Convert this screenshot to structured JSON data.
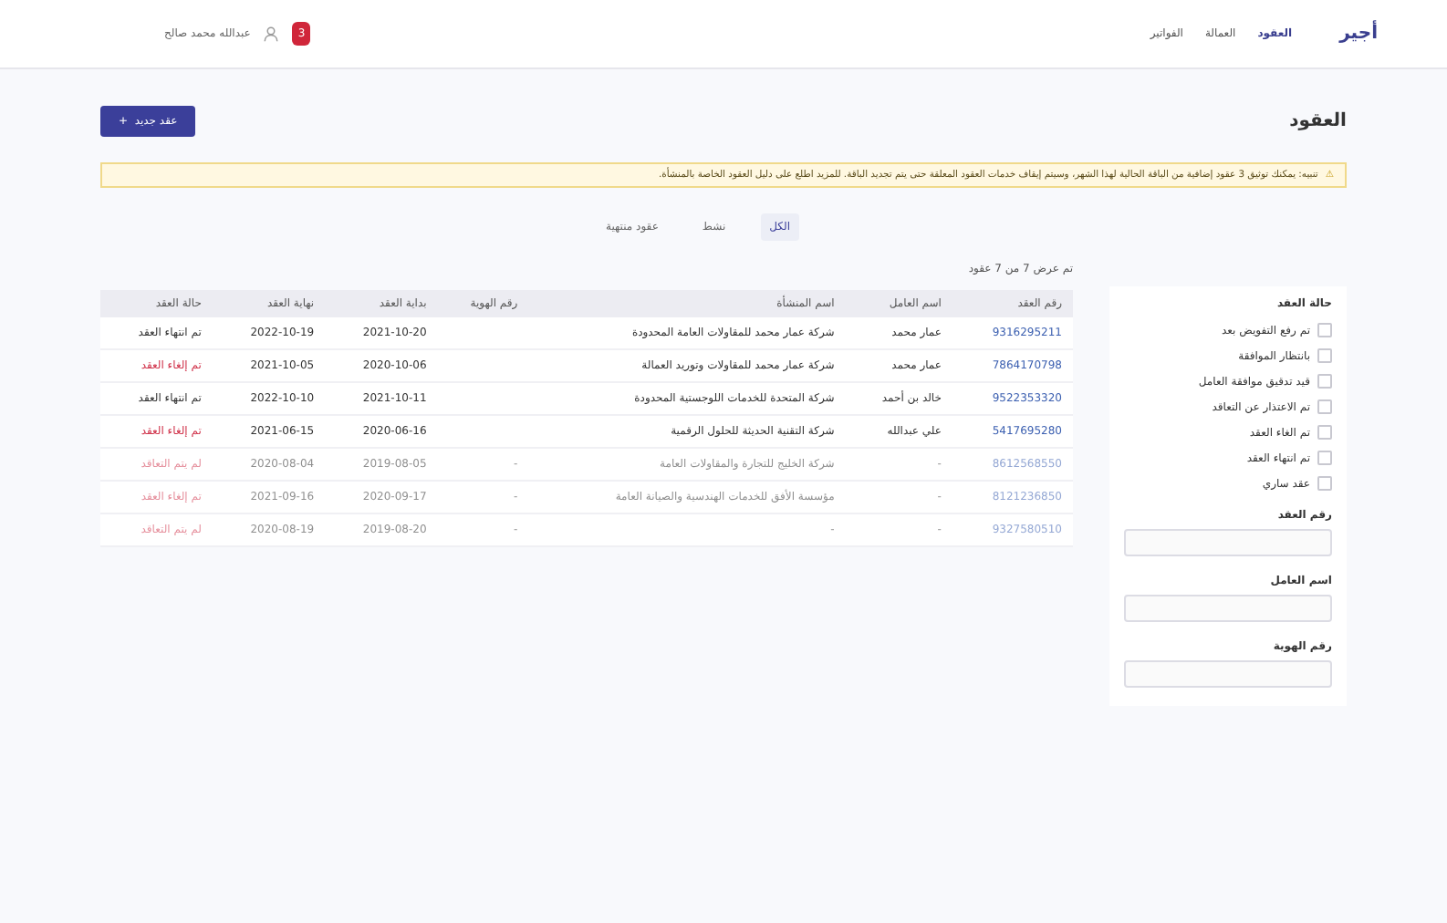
{
  "header": {
    "logo_text": "أجير",
    "nav": [
      {
        "label": "العقود",
        "selected": true
      },
      {
        "label": "العمالة",
        "selected": false
      },
      {
        "label": "الفواتير",
        "selected": false
      }
    ],
    "notifications": "3",
    "user": "عبدالله محمد صالح"
  },
  "page": {
    "title": "العقود",
    "new_button": "عقد جديد",
    "new_icon": "+"
  },
  "alert": {
    "icon": "⚠",
    "text": "تنبيه: يمكنك توثيق 3 عقود إضافية من الباقة الحالية لهذا الشهر، وسيتم إيقاف خدمات العقود المعلقة حتى يتم تجديد الباقة. للمزيد اطلع على دليل العقود الخاصة بالمنشأة."
  },
  "tabs": [
    {
      "label": "الكل",
      "selected": true
    },
    {
      "label": "نشط",
      "selected": false
    },
    {
      "label": "عقود منتهية",
      "selected": false
    }
  ],
  "filters": {
    "title": "حالة العقد",
    "options": [
      {
        "label": "تم رفع التفويض بعد",
        "checked": false
      },
      {
        "label": "بانتظار الموافقة",
        "checked": false
      },
      {
        "label": "قيد تدقيق موافقة العامل",
        "checked": false
      },
      {
        "label": "تم الاعتذار عن التعاقد",
        "checked": false
      },
      {
        "label": "تم الغاء العقد",
        "checked": false
      },
      {
        "label": "تم انتهاء العقد",
        "checked": false
      },
      {
        "label": "عقد ساري",
        "checked": false
      }
    ],
    "fields": [
      {
        "label": "رقم العقد"
      },
      {
        "label": "اسم العامل"
      },
      {
        "label": "رقم الهوية"
      }
    ]
  },
  "table": {
    "summary": "تم عرض 7 من 7 عقود",
    "columns": [
      "رقم العقد",
      "اسم العامل",
      "اسم المنشأة",
      "رقم الهوية",
      "بداية العقد",
      "نهاية العقد",
      "حالة العقد"
    ],
    "rows": [
      {
        "cells": [
          "9316295211",
          "عمار محمد",
          "شركة عمار محمد للمقاولات العامة المحدودة",
          "",
          "2021-10-20",
          "2022-10-19",
          "تم انتهاء العقد"
        ],
        "kind": "active",
        "disabled": false
      },
      {
        "cells": [
          "7864170798",
          "عمار محمد",
          "شركة عمار محمد للمقاولات وتوريد العمالة",
          "",
          "2020-10-06",
          "2021-10-05",
          "تم إلغاء العقد"
        ],
        "kind": "ended",
        "disabled": false
      },
      {
        "cells": [
          "9522353320",
          "خالد بن أحمد",
          "شركة المتحدة للخدمات اللوجستية المحدودة",
          "",
          "2021-10-11",
          "2022-10-10",
          "تم انتهاء العقد"
        ],
        "kind": "active",
        "disabled": false
      },
      {
        "cells": [
          "5417695280",
          "علي عبدالله",
          "شركة التقنية الحديثة للحلول الرقمية",
          "",
          "2020-06-16",
          "2021-06-15",
          "تم إلغاء العقد"
        ],
        "kind": "ended",
        "disabled": false
      },
      {
        "cells": [
          "8612568550",
          "-",
          "شركة الخليج للتجارة والمقاولات العامة",
          "-",
          "2019-08-05",
          "2020-08-04",
          "لم يتم التعاقد"
        ],
        "kind": "ended",
        "disabled": true
      },
      {
        "cells": [
          "8121236850",
          "-",
          "مؤسسة الأفق للخدمات الهندسية والصيانة العامة",
          "-",
          "2020-09-17",
          "2021-09-16",
          "تم إلغاء العقد"
        ],
        "kind": "ended",
        "disabled": true
      },
      {
        "cells": [
          "9327580510",
          "-",
          "-",
          "-",
          "2019-08-20",
          "2020-08-19",
          "لم يتم التعاقد"
        ],
        "kind": "ended",
        "disabled": true
      }
    ]
  }
}
